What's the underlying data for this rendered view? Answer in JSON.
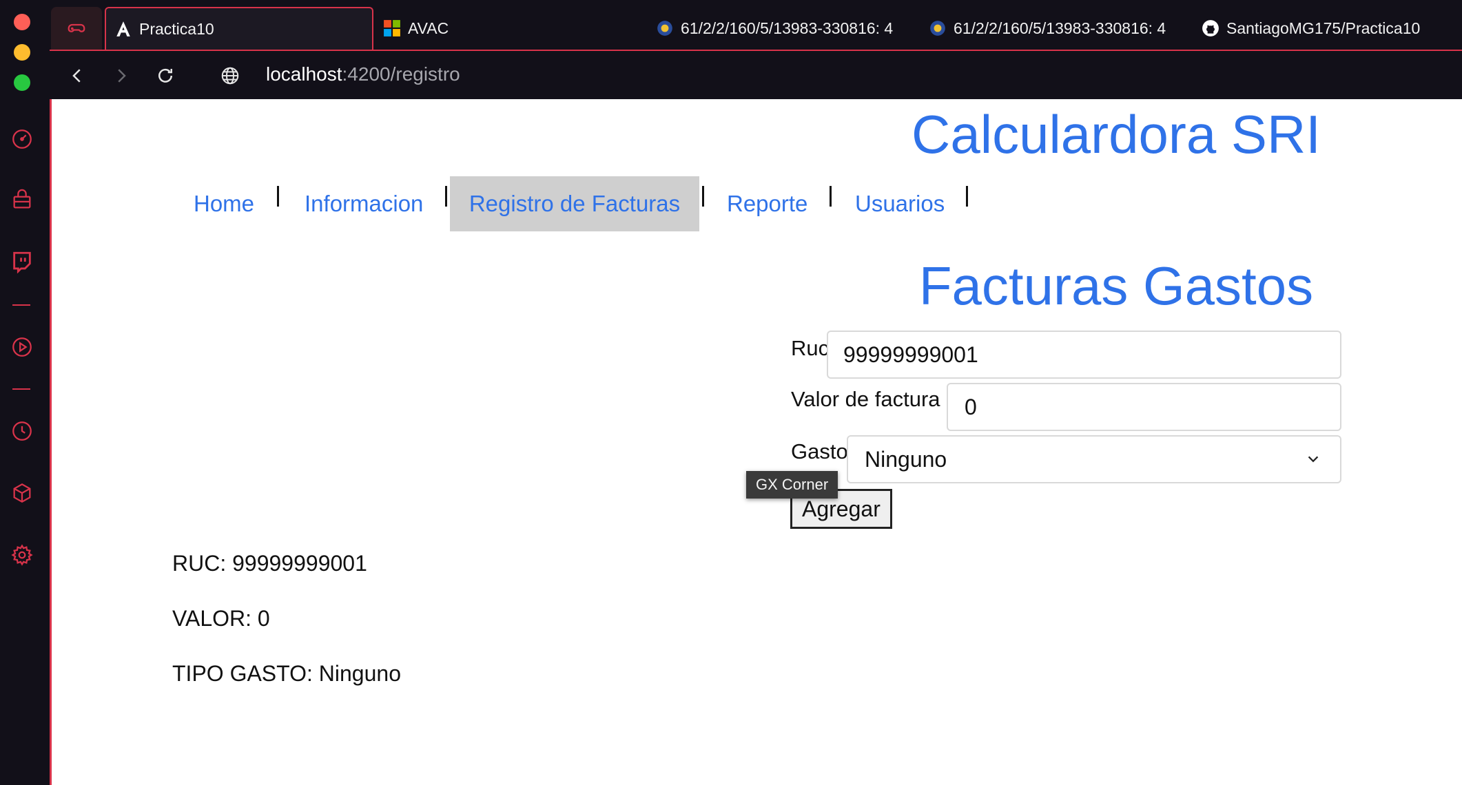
{
  "window": {
    "controls": {
      "close_color": "#ff5f57",
      "minimize_color": "#febc2e",
      "maximize_color": "#28c840"
    }
  },
  "sidebar": {
    "accent": "#d8334a",
    "icons": [
      "speed-dial-icon",
      "shopping-bag-icon",
      "twitch-icon",
      "player-icon",
      "history-icon",
      "box-icon",
      "settings-icon"
    ]
  },
  "tabs": [
    {
      "label": "",
      "icon": "gamepad-icon"
    },
    {
      "label": "Practica10",
      "icon": "angular-icon"
    },
    {
      "label": "AVAC",
      "icon": "microsoft-icon"
    },
    {
      "label": "61/2/2/160/5/13983-330816: 4",
      "icon": "globe-emblem-icon"
    },
    {
      "label": "61/2/2/160/5/13983-330816: 4",
      "icon": "globe-emblem-icon"
    },
    {
      "label": "SantiagoMG175/Practica10",
      "icon": "github-icon"
    }
  ],
  "address": {
    "host": "localhost",
    "path": ":4200/registro"
  },
  "page": {
    "title": "Calculardora SRI",
    "nav": [
      "Home",
      "Informacion",
      "Registro de Facturas",
      "Reporte",
      "Usuarios"
    ],
    "active_nav": "Registro de Facturas",
    "subtitle": "Facturas Gastos",
    "form": {
      "ruc_label": "Ruc",
      "ruc_value": "99999999001",
      "valor_label": "Valor de factura",
      "valor_value": "0",
      "gasto_label": "Gasto",
      "gasto_value": "Ninguno",
      "submit_label": "Agregar"
    },
    "tooltip": "GX Corner",
    "results": {
      "ruc": "RUC: 99999999001",
      "valor": "VALOR: 0",
      "tipo": "TIPO GASTO: Ninguno"
    },
    "link_color": "#2f72e8"
  }
}
